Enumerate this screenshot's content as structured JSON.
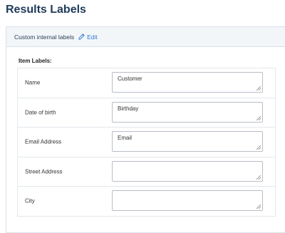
{
  "page": {
    "title": "Results Labels"
  },
  "panel": {
    "header_label": "Custom internal labels",
    "edit_label": "Edit",
    "edit_icon": "pencil-icon",
    "accent": "#2b7bd4"
  },
  "item_labels": {
    "heading": "Item Labels:",
    "rows": [
      {
        "label": "Name",
        "value": "Customer"
      },
      {
        "label": "Date of birth",
        "value": "Birthday"
      },
      {
        "label": "Email Address",
        "value": "Email"
      },
      {
        "label": "Street Address",
        "value": ""
      },
      {
        "label": "City",
        "value": ""
      }
    ]
  }
}
